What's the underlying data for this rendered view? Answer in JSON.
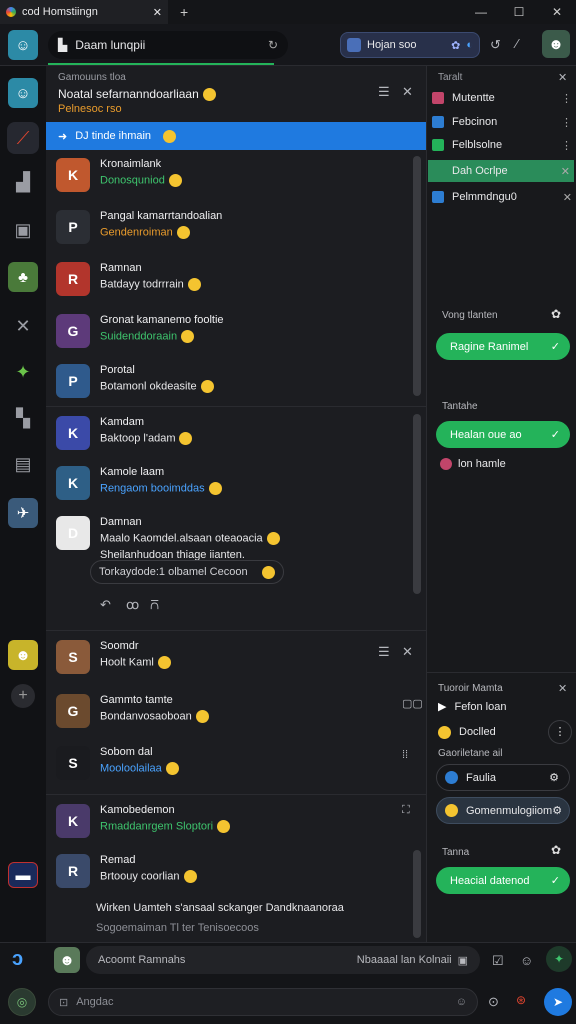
{
  "titlebar": {
    "tab_title": "cod Homstiingn",
    "new_tab": "+",
    "close_tab": "✕",
    "minimize": "—",
    "maximize": "☐",
    "close": "✕"
  },
  "topbar": {
    "search_text": "Daam lunqpii",
    "pill_label": "Hojan soo"
  },
  "conversation": {
    "title": "Noatal sefarnanndoarliaan",
    "subtitle": "Pelnesoc rso",
    "section_label": "Gamouuns tloa",
    "selected": "DJ tinde ihmain"
  },
  "messages": [
    {
      "name": "Kronaimlank",
      "text": "Donosquniod",
      "color": "g",
      "initial": "K",
      "bg": "#c0582e"
    },
    {
      "name": "Pangal kamarrtandoalian",
      "text": "Gendenroiman",
      "color": "o",
      "initial": "P",
      "bg": "#2b2e34"
    },
    {
      "name": "Ramnan",
      "text": "Batdayy todrrrain",
      "color": "w",
      "initial": "R",
      "bg": "#b2352c"
    },
    {
      "name": "Gronat kamanemo fooltie",
      "text": "Suidenddoraain",
      "color": "g",
      "initial": "G",
      "bg": "#5d3a7a"
    },
    {
      "name": "Porotal",
      "text": "Botamonl okdeasite",
      "color": "w",
      "initial": "P",
      "bg": "#2f5a8c"
    },
    {
      "name": "Kamdam",
      "text": "Baktoop l'adam",
      "color": "w",
      "initial": "K",
      "bg": "#3b4aa8"
    },
    {
      "name": "Kamole laam",
      "text": "Rengaom booimddas",
      "color": "b",
      "initial": "K",
      "bg": "#2e5f86"
    },
    {
      "name": "Damnan",
      "text": "Maalo Kaomdel.alsaan oteaoacia",
      "text2": "Sheilanhudoan thiage iianten.",
      "color": "w",
      "initial": "D",
      "bg": "#e8e8e8"
    },
    {
      "name": "Soomdr",
      "text": "Hoolt Kaml",
      "color": "w",
      "initial": "S",
      "bg": "#8a5a3a"
    },
    {
      "name": "Gammto tamte",
      "text": "Bondanvosaoboan",
      "color": "w",
      "initial": "G",
      "bg": "#6b4a2e"
    },
    {
      "name": "Sobom dal",
      "text": "Mooloolailaa",
      "color": "b",
      "initial": "S",
      "bg": "#1a1b1f"
    },
    {
      "name": "Kamobedemon",
      "text": "Rmaddanrgem Sloptori",
      "color": "g",
      "initial": "K",
      "bg": "#4a3a6a"
    },
    {
      "name": "Remad",
      "text": "Brtoouy coorlian",
      "color": "w",
      "initial": "R",
      "bg": "#3a4a6a"
    }
  ],
  "quote_box": "Torkaydode:1 olbamel Cecoon",
  "footer_text": {
    "line1": "Wirken Uamteh s'ansaal sckanger Dandknaanoraa",
    "line2": "Sogoemaiman Tl ter Tenisoecoos"
  },
  "right_panel": {
    "header": "Taralt",
    "items": [
      {
        "label": "Mutentte",
        "color": "#c2456a"
      },
      {
        "label": "Febcinon",
        "color": "#2d7dd2"
      },
      {
        "label": "Felblsolne",
        "color": "#24b35a"
      },
      {
        "label": "Dah Ocrlpe",
        "color": "#2a8c5a"
      },
      {
        "label": "Pelmmdngu0",
        "color": "#2d7dd2"
      }
    ],
    "section1_label": "Vong tlanten",
    "btn1": "Ragine Ranimel",
    "section2_label": "Tantahe",
    "btn2": "Healan oue ao",
    "note": "lon hamle",
    "section3_label": "Tuoroir Mamta",
    "sub_items": [
      "Fefon loan",
      "Doclled"
    ],
    "section4_label": "Gaoriletane ail",
    "pill1": "Faulia",
    "pill2": "Gomenmulogiiom",
    "section5_label": "Tanna",
    "btn3": "Heacial datenod"
  },
  "bottom": {
    "input1_text": "Acoomt Ramnahs",
    "input1_right": "Nbaaaal lan Kolnaii",
    "input2_placeholder": "Angdac"
  },
  "colors": {
    "accent": "#1f7ae0",
    "green": "#24b35a"
  }
}
